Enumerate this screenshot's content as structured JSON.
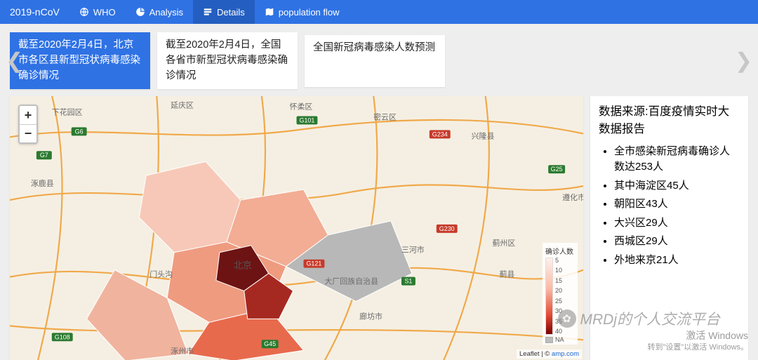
{
  "navbar": {
    "brand": "2019-nCoV",
    "items": [
      {
        "label": "WHO",
        "icon": "globe-icon",
        "active": false
      },
      {
        "label": "Analysis",
        "icon": "pie-icon",
        "active": false
      },
      {
        "label": "Details",
        "icon": "details-icon",
        "active": true
      },
      {
        "label": "population flow",
        "icon": "map-icon",
        "active": false
      }
    ]
  },
  "carousel": {
    "tiles": [
      {
        "text": "截至2020年2月4日，北京市各区县新型冠状病毒感染确诊情况",
        "active": true
      },
      {
        "text": "截至2020年2月4日，全国各省市新型冠状病毒感染确诊情况",
        "active": false
      },
      {
        "text": "全国新冠病毒感染人数预测",
        "active": false
      }
    ]
  },
  "map": {
    "zoom_in": "+",
    "zoom_out": "−",
    "legend_title": "确诊人数",
    "legend_ticks": [
      "5",
      "10",
      "15",
      "20",
      "25",
      "30",
      "35",
      "40"
    ],
    "legend_na": "NA",
    "attribution_prefix": "Leaflet",
    "attribution_sep": " | © ",
    "attribution_link": "amp.com",
    "road_labels": [
      "G6",
      "G7",
      "G101",
      "G234",
      "G25",
      "G121",
      "G230",
      "S1",
      "G108",
      "G45"
    ],
    "place_labels": [
      "延庆区",
      "下花园区",
      "怀柔区",
      "密云区",
      "兴隆县",
      "北京",
      "三河市",
      "蓟州区",
      "蓟县",
      "遵化市",
      "廊坊市",
      "门头沟",
      "大厂回族自治县",
      "涿州市",
      "涿鹿县"
    ]
  },
  "sidebar": {
    "title": "数据来源:百度疫情实时大数据报告",
    "items": [
      "全市感染新冠病毒确诊人数达253人",
      "其中海淀区45人",
      "朝阳区43人",
      "大兴区29人",
      "西城区29人",
      "外地来京21人"
    ]
  },
  "watermark": {
    "text": "MRDj的个人交流平台",
    "icon_glyph": "✿"
  },
  "windows_activate": {
    "line1": "激活 Windows",
    "line2": "转到\"设置\"以激活 Windows。"
  },
  "chart_data": {
    "type": "heatmap",
    "title": "截至2020年2月4日，北京市各区县新型冠状病毒感染确诊情况",
    "xlabel": "",
    "ylabel": "",
    "legend_title": "确诊人数",
    "color_scale_ticks": [
      5,
      10,
      15,
      20,
      25,
      30,
      35,
      40
    ],
    "na_label": "NA",
    "series": [
      {
        "name": "海淀区",
        "value": 45
      },
      {
        "name": "朝阳区",
        "value": 43
      },
      {
        "name": "大兴区",
        "value": 29
      },
      {
        "name": "西城区",
        "value": 29
      },
      {
        "name": "外地来京",
        "value": 21
      }
    ],
    "total": 253
  }
}
